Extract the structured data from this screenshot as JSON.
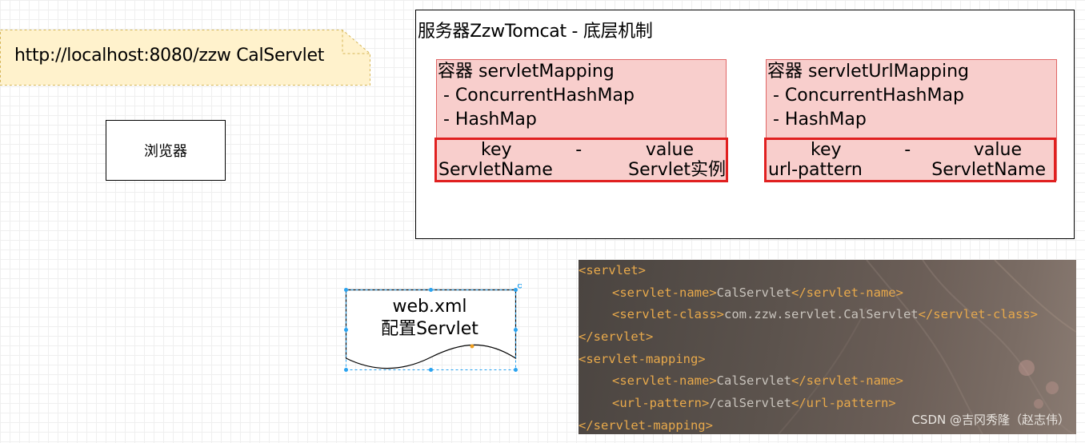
{
  "url_note": {
    "text": "http://localhost:8080/zzw CalServlet"
  },
  "browser": {
    "label": "浏览器"
  },
  "server": {
    "title": "服务器ZzwTomcat - 底层机制",
    "containers": [
      {
        "title": "容器 servletMapping",
        "items": [
          "- ConcurrentHashMap",
          "- HashMap"
        ],
        "kv_header": {
          "key": "key",
          "sep": "-",
          "value": "value"
        },
        "kv_row": {
          "key": "ServletName",
          "value": "Servlet实例"
        }
      },
      {
        "title": "容器 servletUrlMapping",
        "items": [
          "- ConcurrentHashMap",
          "- HashMap"
        ],
        "kv_header": {
          "key": "key",
          "sep": "-",
          "value": "value"
        },
        "kv_row": {
          "key": "url-pattern",
          "value": "ServletName"
        }
      }
    ]
  },
  "doc": {
    "line1": "web.xml",
    "line2": "配置Servlet"
  },
  "code": {
    "lines": [
      {
        "parts": [
          {
            "t": "tag",
            "v": "<servlet>"
          }
        ],
        "indent": false
      },
      {
        "parts": [
          {
            "t": "tag",
            "v": "<servlet-name>"
          },
          {
            "t": "txt",
            "v": "CalServlet"
          },
          {
            "t": "tag",
            "v": "</servlet-name>"
          }
        ],
        "indent": true
      },
      {
        "parts": [
          {
            "t": "tag",
            "v": "<servlet-class>"
          },
          {
            "t": "txt",
            "v": "com.zzw.servlet.CalServlet"
          },
          {
            "t": "tag",
            "v": "</servlet-class>"
          }
        ],
        "indent": true
      },
      {
        "parts": [
          {
            "t": "tag",
            "v": "</servlet>"
          }
        ],
        "indent": false
      },
      {
        "parts": [
          {
            "t": "tag",
            "v": "<servlet-mapping>"
          }
        ],
        "indent": false
      },
      {
        "parts": [
          {
            "t": "tag",
            "v": "<servlet-name>"
          },
          {
            "t": "txt",
            "v": "CalServlet"
          },
          {
            "t": "tag",
            "v": "</servlet-name>"
          }
        ],
        "indent": true
      },
      {
        "parts": [
          {
            "t": "tag",
            "v": "<url-pattern>"
          },
          {
            "t": "txt",
            "v": "/calServlet"
          },
          {
            "t": "tag",
            "v": "</url-pattern>"
          }
        ],
        "indent": true
      },
      {
        "parts": [
          {
            "t": "tag",
            "v": "</servlet-mapping>"
          }
        ],
        "indent": false
      }
    ],
    "watermark": "CSDN @吉冈秀隆（赵志伟）"
  },
  "colors": {
    "note_fill": "#fff2cc",
    "note_border": "#d6b656",
    "container_fill": "#f8cecc",
    "container_border": "#e06666",
    "highlight_border": "#e02020",
    "code_tag": "#e8a94b",
    "code_text": "#c9c4bd",
    "selection_handle": "#29a3f0"
  }
}
